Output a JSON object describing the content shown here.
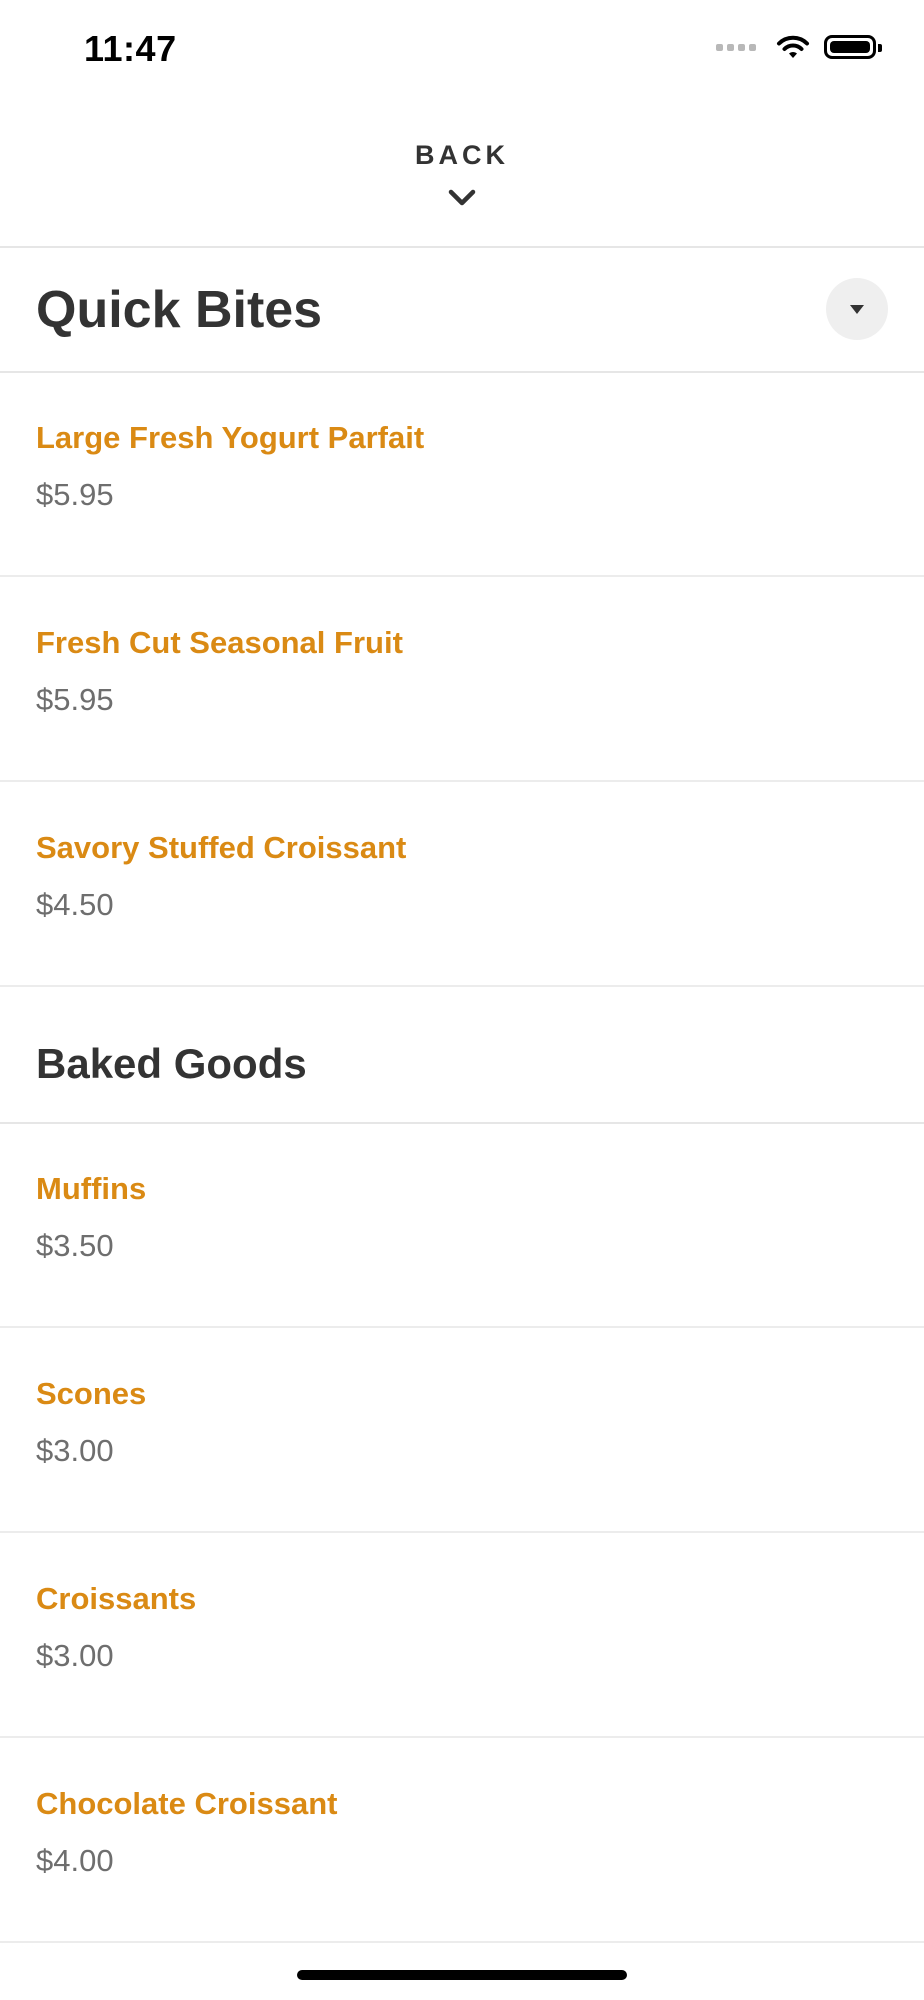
{
  "status_bar": {
    "time": "11:47"
  },
  "nav": {
    "back_label": "BACK"
  },
  "sections": [
    {
      "title": "Quick Bites",
      "items": [
        {
          "name": "Large Fresh Yogurt Parfait",
          "price": "$5.95"
        },
        {
          "name": "Fresh Cut Seasonal Fruit",
          "price": "$5.95"
        },
        {
          "name": "Savory Stuffed Croissant",
          "price": "$4.50"
        }
      ]
    },
    {
      "title": "Baked Goods",
      "items": [
        {
          "name": "Muffins",
          "price": "$3.50"
        },
        {
          "name": "Scones",
          "price": "$3.00"
        },
        {
          "name": "Croissants",
          "price": "$3.00"
        },
        {
          "name": "Chocolate Croissant",
          "price": "$4.00"
        }
      ]
    }
  ],
  "colors": {
    "item_name": "#da8a14",
    "price": "#6e6e6e",
    "title": "#333333"
  },
  "icons": {
    "back": "chevron-down-icon",
    "collapse": "caret-down-icon"
  }
}
